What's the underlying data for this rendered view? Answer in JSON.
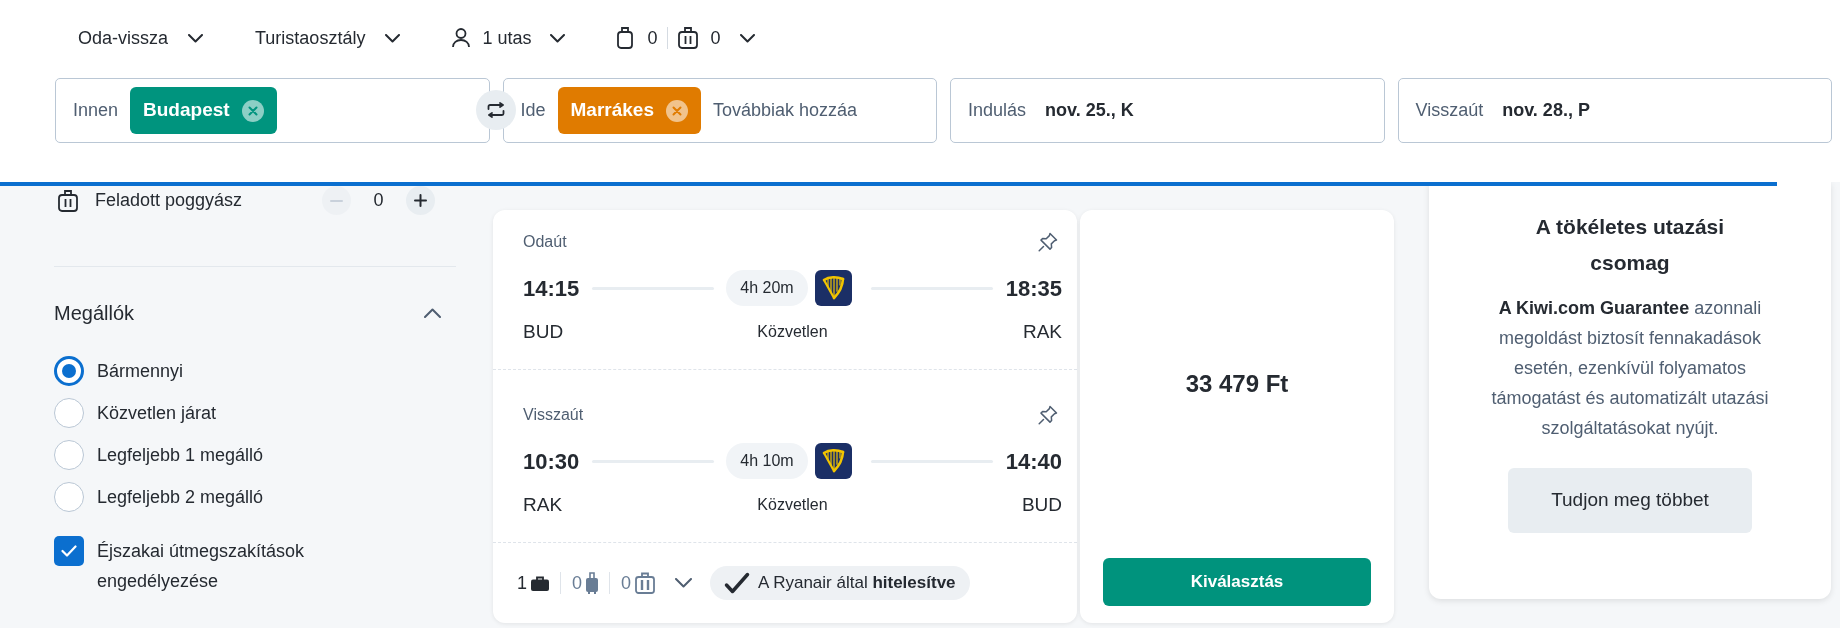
{
  "top_bar": {
    "options": [
      {
        "kind": "trip",
        "label": "Oda-vissza"
      },
      {
        "kind": "cabin",
        "label": "Turistaosztály"
      },
      {
        "kind": "passengers",
        "label": "1 utas"
      },
      {
        "kind": "bags",
        "cabin_bags": "0",
        "checked_bags": "0"
      }
    ]
  },
  "search": {
    "fields": [
      {
        "kind": "origin",
        "label": "Innen",
        "tags": [
          "Budapest"
        ]
      },
      {
        "kind": "destination",
        "label": "Ide",
        "tags": [
          "Marrákes"
        ],
        "placeholder": "Továbbiak hozzáa"
      },
      {
        "kind": "date",
        "label": "Indulás",
        "value": "nov. 25., K"
      },
      {
        "kind": "date",
        "label": "Visszaút",
        "value": "nov. 28., P"
      }
    ]
  },
  "loading_bar": {
    "level": 0.966
  },
  "sidebar": {
    "checked_baggage": {
      "label": "Feladott poggyász",
      "count": "0",
      "decrement_disabled": true
    },
    "stops": {
      "title": "Megállók",
      "expanded": true,
      "options": [
        {
          "label": "Bármennyi",
          "selected": true
        },
        {
          "label": "Közvetlen járat",
          "selected": false
        },
        {
          "label": "Legfeljebb 1 megálló",
          "selected": false
        },
        {
          "label": "Legfeljebb 2 megálló",
          "selected": false
        }
      ],
      "overnight": {
        "label": "Éjszakai útmegszakítások engedélyezése",
        "checked": true
      }
    }
  },
  "result": {
    "legs": [
      {
        "title": "Odaút",
        "depart_time": "14:15",
        "arrive_time": "18:35",
        "duration": "4h 20m",
        "from": "BUD",
        "to": "RAK",
        "stops": "Közvetlen"
      },
      {
        "title": "Visszaút",
        "depart_time": "10:30",
        "arrive_time": "14:40",
        "duration": "4h 10m",
        "from": "RAK",
        "to": "BUD",
        "stops": "Közvetlen"
      }
    ],
    "baggage": [
      {
        "kind": "personal",
        "count": "1",
        "included": true
      },
      {
        "kind": "cabin",
        "count": "0",
        "included": false
      },
      {
        "kind": "checked",
        "count": "0",
        "included": false
      }
    ],
    "badge": "A Ryanair által **hitelesítve**",
    "price": "33 479 Ft",
    "select_button": "Kiválasztás"
  },
  "promo": {
    "title": "A tökéletes utazási csomag",
    "text": "**A Kiwi.com Guarantee** azonnali megoldást biztosít fennakadások esetén, ezenkívül folyamatos támogatást és automatizált utazási szolgáltatásokat nyújt.",
    "button": "Tudjon meg többet"
  }
}
